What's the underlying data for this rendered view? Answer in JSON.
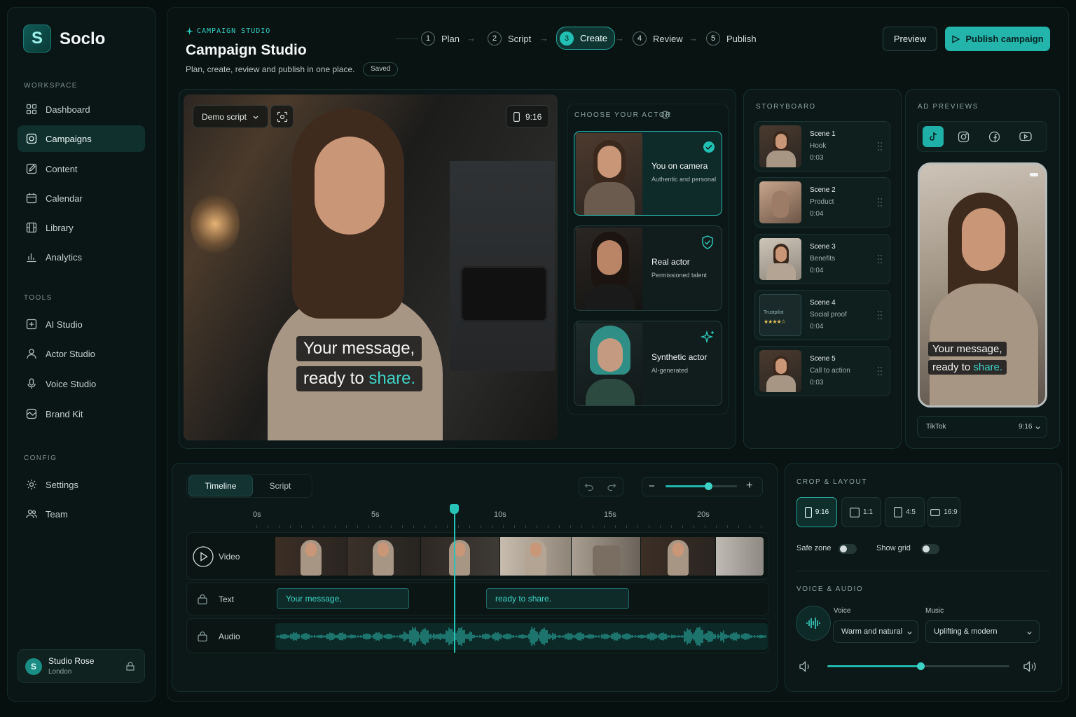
{
  "app": {
    "name": "Soclo"
  },
  "sidebar": {
    "sections": {
      "workspace": "WORKSPACE",
      "tools": "TOOLS",
      "config": "CONFIG"
    },
    "items": [
      {
        "label": "Dashboard",
        "icon": "grid-icon"
      },
      {
        "label": "Campaigns",
        "icon": "target-icon"
      },
      {
        "label": "Content",
        "icon": "edit-icon"
      },
      {
        "label": "Calendar",
        "icon": "calendar-icon"
      },
      {
        "label": "Library",
        "icon": "film-icon"
      },
      {
        "label": "Analytics",
        "icon": "bar-chart-icon"
      },
      {
        "label": "AI Studio",
        "icon": "ai-chip-icon"
      },
      {
        "label": "Actor Studio",
        "icon": "user-icon"
      },
      {
        "label": "Voice Studio",
        "icon": "microphone-icon"
      },
      {
        "label": "Brand Kit",
        "icon": "palette-icon"
      },
      {
        "label": "Settings",
        "icon": "gear-icon"
      },
      {
        "label": "Team",
        "icon": "team-icon"
      }
    ],
    "user": {
      "initial": "S",
      "name": "Studio Rose",
      "location": "London"
    }
  },
  "header": {
    "tag": "CAMPAIGN STUDIO",
    "title": "Campaign Studio",
    "subtitle": "Plan, create, review and publish in one place.",
    "status": "Saved",
    "steps": [
      {
        "num": "1",
        "label": "Plan"
      },
      {
        "num": "2",
        "label": "Script"
      },
      {
        "num": "3",
        "label": "Create"
      },
      {
        "num": "4",
        "label": "Review"
      },
      {
        "num": "5",
        "label": "Publish"
      }
    ],
    "active_step": 3,
    "preview_label": "Preview",
    "publish_label": "Publish campaign"
  },
  "video": {
    "script_select": "Demo script",
    "ratio": "9:16",
    "caption_line1": "Your message,",
    "caption_line2_prefix": "ready to",
    "caption_line2_highlight": "share."
  },
  "actors": {
    "title": "CHOOSE YOUR ACTOR",
    "options": [
      {
        "name": "You on camera",
        "desc": "Authentic and personal",
        "selected": true
      },
      {
        "name": "Real actor",
        "desc": "Permissioned talent",
        "selected": false
      },
      {
        "name": "Synthetic actor",
        "desc": "AI-generated",
        "selected": false
      }
    ]
  },
  "storyboard": {
    "title": "STORYBOARD",
    "scenes": [
      {
        "name": "Scene 1",
        "type": "Hook",
        "duration": "0:03"
      },
      {
        "name": "Scene 2",
        "type": "Product",
        "duration": "0:04"
      },
      {
        "name": "Scene 3",
        "type": "Benefits",
        "duration": "0:04"
      },
      {
        "name": "Scene 4",
        "type": "Social proof",
        "duration": "0:04",
        "thumb_text": "Trustpilot"
      },
      {
        "name": "Scene 5",
        "type": "Call to action",
        "duration": "0:03"
      }
    ]
  },
  "ad_previews": {
    "title": "AD PREVIEWS",
    "platforms": [
      "tiktok-icon",
      "instagram-icon",
      "facebook-icon",
      "youtube-icon"
    ],
    "active_platform": "tiktok-icon",
    "caption_line1": "Your message,",
    "caption_line2_prefix": "ready to",
    "caption_line2_highlight": "share.",
    "platform_select": "TikTok",
    "ratio_select": "9:16"
  },
  "timeline": {
    "tabs": [
      "Timeline",
      "Script"
    ],
    "active_tab": "Timeline",
    "zoom_level": 0.6,
    "ticks": [
      "0s",
      "5s",
      "10s",
      "15s",
      "20s"
    ],
    "playhead_seconds": 8.3,
    "tracks": [
      {
        "label": "Video"
      },
      {
        "label": "Text"
      },
      {
        "label": "Audio"
      }
    ],
    "text_clips": [
      "Your message,",
      "ready to share."
    ]
  },
  "crop": {
    "title": "CROP & LAYOUT",
    "ratios": [
      "9:16",
      "1:1",
      "4:5",
      "16:9"
    ],
    "active_ratio": "9:16",
    "safe_zone_label": "Safe zone",
    "safe_zone_on": false,
    "show_grid_label": "Show grid",
    "show_grid_on": false
  },
  "audio": {
    "title": "VOICE & AUDIO",
    "voice_label": "Voice",
    "voice_value": "Warm and natural",
    "music_label": "Music",
    "music_value": "Uplifting & modern",
    "volume": 0.51
  },
  "colors": {
    "accent": "#23b4ab",
    "accent_text": "#3fd4c8",
    "bg": "#06100f",
    "panel": "#0b1817"
  }
}
